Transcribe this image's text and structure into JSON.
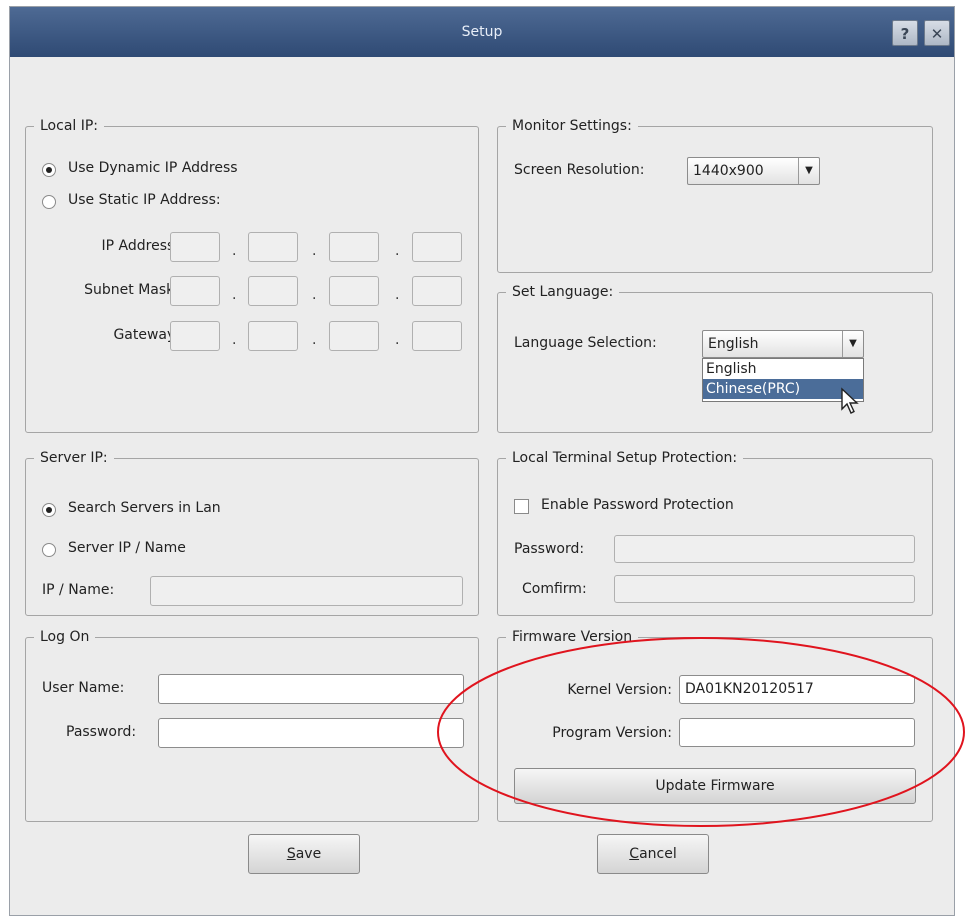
{
  "window": {
    "title": "Setup",
    "help_button": "?",
    "close_button": "✕"
  },
  "local_ip": {
    "legend": "Local IP:",
    "dynamic_label": "Use Dynamic IP Address",
    "static_label": "Use Static IP Address:",
    "selected": "dynamic",
    "ip_label": "IP Address:",
    "subnet_label": "Subnet Mask:",
    "gateway_label": "Gateway:",
    "separator": "."
  },
  "monitor": {
    "legend": "Monitor Settings:",
    "resolution_label": "Screen Resolution:",
    "resolution_value": "1440x900"
  },
  "language": {
    "legend": "Set Language:",
    "selection_label": "Language Selection:",
    "selected_value": "English",
    "options": [
      "English",
      "Chinese(PRC)"
    ],
    "highlighted_option": "Chinese(PRC)"
  },
  "server_ip": {
    "legend": "Server IP:",
    "search_label": "Search Servers in Lan",
    "manual_label": "Server IP / Name",
    "selected": "search",
    "ip_name_label": "IP / Name:",
    "ip_name_value": ""
  },
  "protection": {
    "legend": "Local Terminal Setup Protection:",
    "enable_label": "Enable Password Protection",
    "enabled": false,
    "password_label": "Password:",
    "confirm_label": "Comfirm:"
  },
  "logon": {
    "legend": "Log On",
    "username_label": "User Name:",
    "username_value": "",
    "password_label": "Password:",
    "password_value": ""
  },
  "firmware": {
    "legend": "Firmware Version",
    "kernel_label": "Kernel Version:",
    "kernel_value": "DA01KN20120517",
    "program_label": "Program Version:",
    "program_value": "",
    "update_button": "Update Firmware"
  },
  "footer": {
    "save_mnemonic": "S",
    "save_rest": "ave",
    "cancel_mnemonic": "C",
    "cancel_rest": "ancel"
  },
  "annotation_color": "#e0141e",
  "titlebar_color": "#3d5782"
}
